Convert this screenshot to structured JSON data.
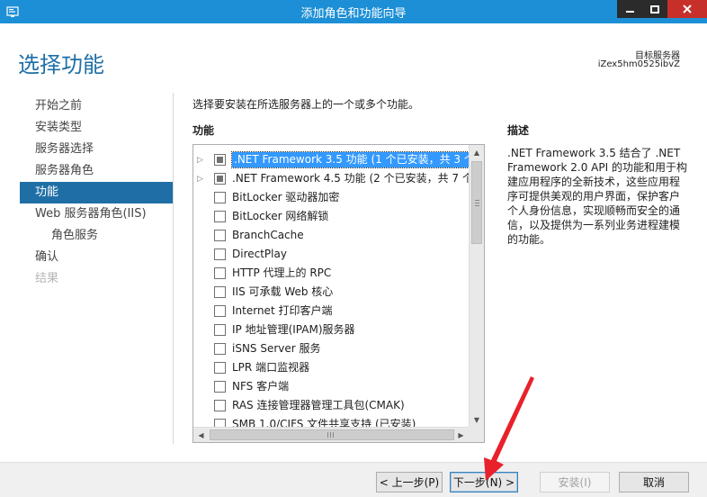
{
  "window": {
    "title": "添加角色和功能向导"
  },
  "header": {
    "page_title": "选择功能",
    "destination_label": "目标服务器",
    "destination_value": "iZex5hm0525ibvZ"
  },
  "nav": [
    {
      "label": "开始之前",
      "state": "normal",
      "sub": false
    },
    {
      "label": "安装类型",
      "state": "normal",
      "sub": false
    },
    {
      "label": "服务器选择",
      "state": "normal",
      "sub": false
    },
    {
      "label": "服务器角色",
      "state": "normal",
      "sub": false
    },
    {
      "label": "功能",
      "state": "active",
      "sub": false
    },
    {
      "label": "Web 服务器角色(IIS)",
      "state": "normal",
      "sub": false
    },
    {
      "label": "角色服务",
      "state": "normal",
      "sub": true
    },
    {
      "label": "确认",
      "state": "normal",
      "sub": false
    },
    {
      "label": "结果",
      "state": "disabled",
      "sub": false
    }
  ],
  "content": {
    "instruction": "选择要安装在所选服务器上的一个或多个功能。",
    "features_heading": "功能",
    "description_heading": "描述",
    "description_text": ".NET Framework 3.5 结合了 .NET Framework 2.0 API 的功能和用于构建应用程序的全新技术，这些应用程序可提供美观的用户界面，保护客户个人身份信息，实现顺畅而安全的通信，以及提供为一系列业务进程建模的功能。"
  },
  "features": [
    {
      "label": ".NET Framework 3.5 功能 (1 个已安装，共 3 个)",
      "expandable": true,
      "state": "partial",
      "selected": true
    },
    {
      "label": ".NET Framework 4.5 功能 (2 个已安装，共 7 个)",
      "expandable": true,
      "state": "partial",
      "selected": false
    },
    {
      "label": "BitLocker 驱动器加密",
      "expandable": false,
      "state": "unchecked",
      "selected": false
    },
    {
      "label": "BitLocker 网络解锁",
      "expandable": false,
      "state": "unchecked",
      "selected": false
    },
    {
      "label": "BranchCache",
      "expandable": false,
      "state": "unchecked",
      "selected": false
    },
    {
      "label": "DirectPlay",
      "expandable": false,
      "state": "unchecked",
      "selected": false
    },
    {
      "label": "HTTP 代理上的 RPC",
      "expandable": false,
      "state": "unchecked",
      "selected": false
    },
    {
      "label": "IIS 可承载 Web 核心",
      "expandable": false,
      "state": "unchecked",
      "selected": false
    },
    {
      "label": "Internet 打印客户端",
      "expandable": false,
      "state": "unchecked",
      "selected": false
    },
    {
      "label": "IP 地址管理(IPAM)服务器",
      "expandable": false,
      "state": "unchecked",
      "selected": false
    },
    {
      "label": "iSNS Server 服务",
      "expandable": false,
      "state": "unchecked",
      "selected": false
    },
    {
      "label": "LPR 端口监视器",
      "expandable": false,
      "state": "unchecked",
      "selected": false
    },
    {
      "label": "NFS 客户端",
      "expandable": false,
      "state": "unchecked",
      "selected": false
    },
    {
      "label": "RAS 连接管理器管理工具包(CMAK)",
      "expandable": false,
      "state": "unchecked",
      "selected": false
    },
    {
      "label": "SMB 1.0/CIFS 文件共享支持 (已安装)",
      "expandable": false,
      "state": "checked",
      "selected": false
    }
  ],
  "buttons": {
    "prev": "< 上一步(P)",
    "next": "下一步(N) >",
    "install": "安装(I)",
    "cancel": "取消"
  },
  "colors": {
    "titlebar": "#1d8fd6",
    "accent": "#1f6fa6",
    "selection": "#3399ff",
    "close_button": "#c7302a",
    "annotation_arrow": "#e8212b"
  }
}
